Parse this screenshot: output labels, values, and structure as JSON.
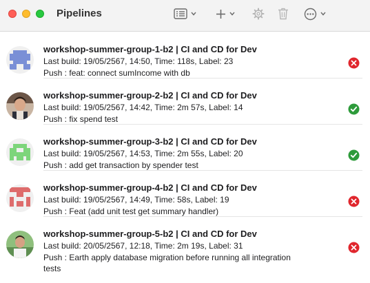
{
  "window": {
    "title": "Pipelines"
  },
  "toolbar": {
    "icons": [
      "sidebar-list-icon",
      "chevron-down-icon",
      "plus-icon",
      "gear-icon",
      "trash-icon",
      "ellipsis-circle-icon"
    ]
  },
  "pipelines": [
    {
      "name": "workshop-summer-group-1-b2 | CI and CD for Dev",
      "meta": "Last build: 19/05/2567, 14:50, Time: 118s, Label: 23",
      "push": "Push : feat: connect sumIncome with db",
      "status": "failed",
      "avatar": "blue-pixel-avatar"
    },
    {
      "name": "workshop-summer-group-2-b2 | CI and CD for Dev",
      "meta": "Last build: 19/05/2567, 14:42, Time: 2m 57s, Label: 14",
      "push": "Push : fix spend test",
      "status": "success",
      "avatar": "photo-avatar"
    },
    {
      "name": "workshop-summer-group-3-b2 | CI and CD for Dev",
      "meta": "Last build: 19/05/2567, 14:53, Time: 2m 55s, Label: 20",
      "push": "Push : add get transaction by spender test",
      "status": "success",
      "avatar": "green-pixel-avatar"
    },
    {
      "name": "workshop-summer-group-4-b2 | CI and CD for Dev",
      "meta": "Last build: 19/05/2567, 14:49, Time: 58s, Label: 19",
      "push": "Push : Feat (add unit test get summary handler)",
      "status": "failed",
      "avatar": "red-pixel-avatar"
    },
    {
      "name": "workshop-summer-group-5-b2 | CI and CD for Dev",
      "meta": "Last build: 20/05/2567, 12:18, Time: 2m 19s, Label: 31",
      "push": "Push : Earth apply database migration before running all integration tests",
      "status": "failed",
      "avatar": "photo-avatar"
    }
  ],
  "colors": {
    "failed": "#e0262d",
    "success": "#2e9b3b"
  }
}
